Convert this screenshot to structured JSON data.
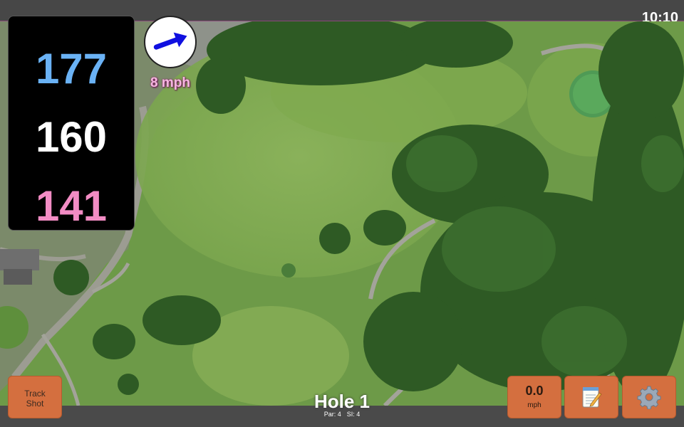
{
  "status": {
    "time": "10:10"
  },
  "distances": {
    "back": "177",
    "middle": "160",
    "front": "141"
  },
  "wind": {
    "speed": "8 mph",
    "icon": "wind-arrow-icon"
  },
  "buttons": {
    "track_shot_line1": "Track",
    "track_shot_line2": "Shot",
    "speed_value": "0.0",
    "speed_unit": "mph",
    "notes_icon": "notepad-icon",
    "settings_icon": "gear-icon"
  },
  "hole": {
    "title": "Hole 1",
    "par": "Par: 4",
    "si": "SI: 4"
  },
  "colors": {
    "back_distance": "#6ab2f5",
    "middle_distance": "#ffffff",
    "front_distance": "#f28cc4",
    "button": "#d46f3f",
    "wind_arrow": "#1010e0"
  }
}
